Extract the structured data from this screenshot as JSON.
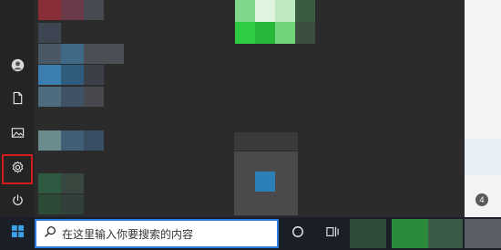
{
  "taskbar": {
    "search_placeholder": "在这里输入你要搜索的内容",
    "start_icon": "windows-logo-icon",
    "cortana_icon": "circle-icon",
    "task_view_icon": "task-view-icon"
  },
  "start_menu": {
    "rail": [
      {
        "name": "user-account",
        "icon": "user-icon"
      },
      {
        "name": "documents",
        "icon": "document-icon"
      },
      {
        "name": "pictures",
        "icon": "picture-icon"
      },
      {
        "name": "settings",
        "icon": "gear-icon",
        "highlighted": true
      },
      {
        "name": "power",
        "icon": "power-icon"
      }
    ]
  },
  "colors": {
    "highlight": "#d21c1c",
    "search_border": "#2b7be0",
    "tile_green": "#2ecc40",
    "tile_blue": "#3a7fb0"
  }
}
